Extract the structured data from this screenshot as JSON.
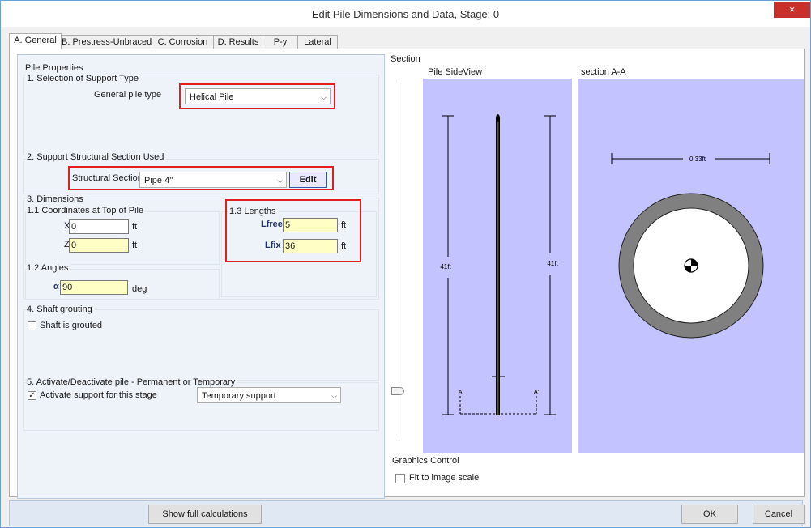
{
  "window": {
    "title": "Edit Pile Dimensions and Data, Stage: 0",
    "close_label": "×"
  },
  "tabs": [
    {
      "label": "A. General"
    },
    {
      "label": "B. Prestress-Unbraced"
    },
    {
      "label": "C. Corrosion"
    },
    {
      "label": "D. Results"
    },
    {
      "label": "P-y"
    },
    {
      "label": "Lateral"
    }
  ],
  "pile_properties": {
    "heading": "Pile Properties",
    "support_type": {
      "heading": "1. Selection of Support Type",
      "label": "General pile type",
      "value": "Helical Pile"
    },
    "structural_section": {
      "heading": "2. Support Structural Section Used",
      "label": "Structural Section",
      "value": "Pipe 4''",
      "edit_label": "Edit"
    },
    "dimensions": {
      "heading": "3. Dimensions",
      "coordinates": {
        "heading": "1.1 Coordinates at Top of Pile",
        "x_label": "X",
        "x_value": "0",
        "x_unit": "ft",
        "z_label": "Z",
        "z_value": "0",
        "z_unit": "ft"
      },
      "lengths": {
        "heading": "1.3 Lengths",
        "lfree_label": "Lfree",
        "lfree_value": "5",
        "lfree_unit": "ft",
        "lfix_label": "Lfix",
        "lfix_value": "36",
        "lfix_unit": "ft"
      },
      "angles": {
        "heading": "1.2 Angles",
        "alpha_label": "α",
        "alpha_value": "90",
        "alpha_unit": "deg"
      }
    },
    "grouting": {
      "heading": "4. Shaft grouting",
      "checkbox_label": "Shaft is grouted",
      "checked": false
    },
    "activate": {
      "heading": "5. Activate/Deactivate pile - Permanent or Temporary",
      "checkbox_label": "Activate support for this stage",
      "checked": true,
      "mode_value": "Temporary support"
    }
  },
  "section": {
    "heading": "Section",
    "side_view_title": "Pile SideView",
    "section_title": "section A-A",
    "left_dim_label": "41ft",
    "right_dim_label": "41ft",
    "diameter_label": "0.33ft",
    "marker_a": "A",
    "marker_a_prime": "A'",
    "graphics_control": {
      "heading": "Graphics Control",
      "fit_label": "Fit to image scale",
      "fit_checked": false
    }
  },
  "footer": {
    "show_calc_label": "Show full calculations",
    "ok_label": "OK",
    "cancel_label": "Cancel"
  },
  "colors": {
    "highlight_red": "#e02020",
    "input_yellow": "#fffec5",
    "view_background": "#c3c3ff",
    "ring_gray": "#808080",
    "close_red": "#c7302b"
  }
}
